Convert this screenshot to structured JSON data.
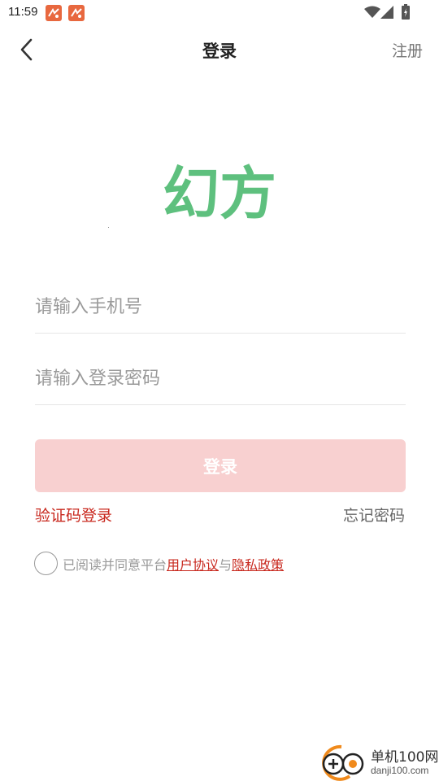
{
  "status_bar": {
    "time": "11:59",
    "notification_icons": [
      "app-notification-icon",
      "app-notification-icon"
    ],
    "system_icons": [
      "wifi-icon",
      "cellular-signal-icon",
      "battery-charging-icon"
    ]
  },
  "nav": {
    "back_icon": "chevron-left-icon",
    "title": "登录",
    "register_label": "注册"
  },
  "logo": {
    "text": "幻方",
    "color": "#5ec07e"
  },
  "form": {
    "phone_placeholder": "请输入手机号",
    "phone_value": "",
    "password_placeholder": "请输入登录密码",
    "password_value": "",
    "login_button_label": "登录",
    "login_button_color": "#f8d0d0",
    "sms_login_label": "验证码登录",
    "forgot_password_label": "忘记密码"
  },
  "agreement": {
    "checked": false,
    "prefix": "已阅读并同意平台",
    "user_agreement_label": "用户协议",
    "conjunction": "与",
    "privacy_policy_label": "隐私政策",
    "link_color": "#c8281e"
  },
  "watermark": {
    "name": "单机100网",
    "url": "danji100.com"
  },
  "colors": {
    "accent_red": "#c8281e",
    "logo_green": "#5ec07e"
  }
}
